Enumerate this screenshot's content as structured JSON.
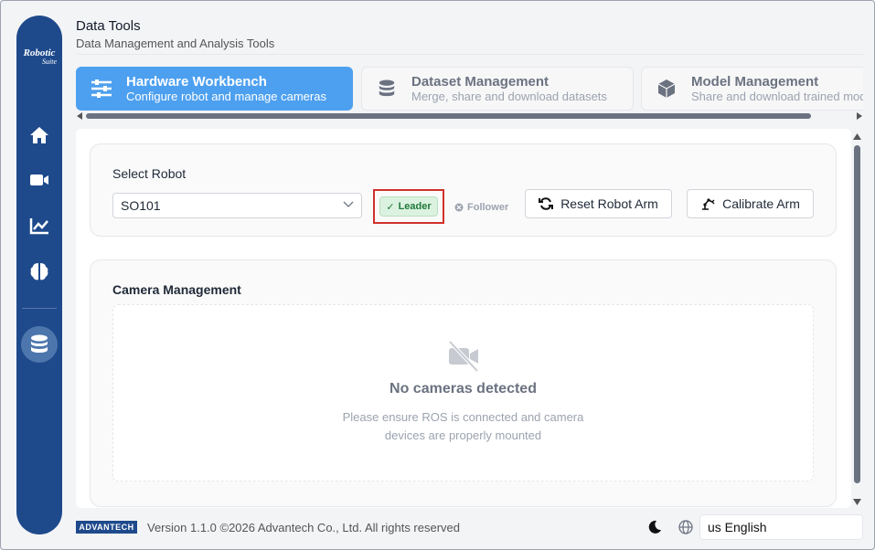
{
  "app": {
    "logo_main": "Robotic",
    "logo_sub": "Suite"
  },
  "header": {
    "title": "Data Tools",
    "subtitle": "Data Management and Analysis Tools"
  },
  "tabs": [
    {
      "title": "Hardware Workbench",
      "subtitle": "Configure robot and manage cameras",
      "icon": "sliders-icon",
      "active": true
    },
    {
      "title": "Dataset Management",
      "subtitle": "Merge, share and download datasets",
      "icon": "database-icon",
      "active": false
    },
    {
      "title": "Model Management",
      "subtitle": "Share and download trained models",
      "icon": "cube-icon",
      "active": false
    }
  ],
  "robot": {
    "section_title": "Select Robot",
    "selected": "SO101",
    "leader_label": "Leader",
    "follower_label": "Follower",
    "reset_label": "Reset Robot Arm",
    "calibrate_label": "Calibrate Arm"
  },
  "camera": {
    "section_title": "Camera Management",
    "empty_title": "No cameras detected",
    "empty_message": "Please ensure ROS is connected and camera devices are properly mounted"
  },
  "footer": {
    "brand": "ADVANTECH",
    "version_text": "Version 1.1.0 ©2026 Advantech Co., Ltd. All rights reserved",
    "language": "us  English"
  },
  "colors": {
    "sidebar": "#1e4a8c",
    "accent": "#4da0ef",
    "leader_bg": "#dcf2e0",
    "highlight": "#d0312d"
  }
}
